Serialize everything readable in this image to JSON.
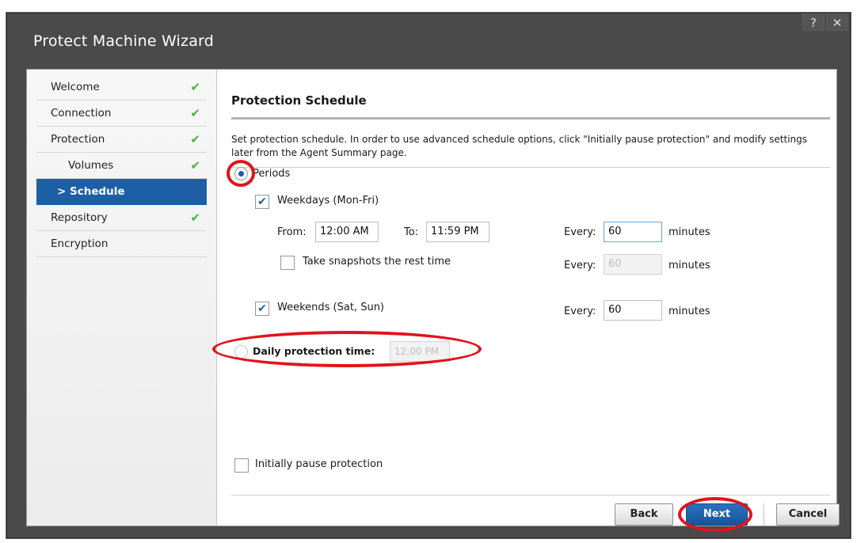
{
  "window": {
    "title": "Protect Machine Wizard",
    "help_label": "?",
    "close_label": "✕"
  },
  "sidebar": {
    "items": [
      {
        "label": "Welcome",
        "done": true
      },
      {
        "label": "Connection",
        "done": true
      },
      {
        "label": "Protection",
        "done": true
      },
      {
        "label": "Volumes",
        "done": true
      },
      {
        "label": "> Schedule",
        "done": false
      },
      {
        "label": "Repository",
        "done": true
      },
      {
        "label": "Encryption",
        "done": false
      }
    ],
    "check_glyph": "✔"
  },
  "content": {
    "title": "Protection Schedule",
    "description": "Set protection schedule. In order to use advanced schedule options, click \"Initially pause protection\" and modify settings later from the Agent Summary page.",
    "periods_label": "Periods",
    "weekdays_label": "Weekdays (Mon-Fri)",
    "from_label": "From:",
    "from_value": "12:00 AM",
    "to_label": "To:",
    "to_value": "11:59 PM",
    "every_label": "Every:",
    "weekday_every_value": "60",
    "minutes_label": "minutes",
    "rest_time_label": "Take snapshots the rest time",
    "rest_every_value": "60",
    "weekends_label": "Weekends (Sat, Sun)",
    "weekend_every_value": "60",
    "daily_label": "Daily protection time:",
    "daily_value": "12:00 PM",
    "pause_label": "Initially pause protection",
    "check_glyph": "✔"
  },
  "buttons": {
    "back": "Back",
    "next": "Next",
    "cancel": "Cancel"
  },
  "colors": {
    "accent": "#1d5fa5",
    "check": "#4bb33b",
    "annotation": "#e0141a"
  }
}
